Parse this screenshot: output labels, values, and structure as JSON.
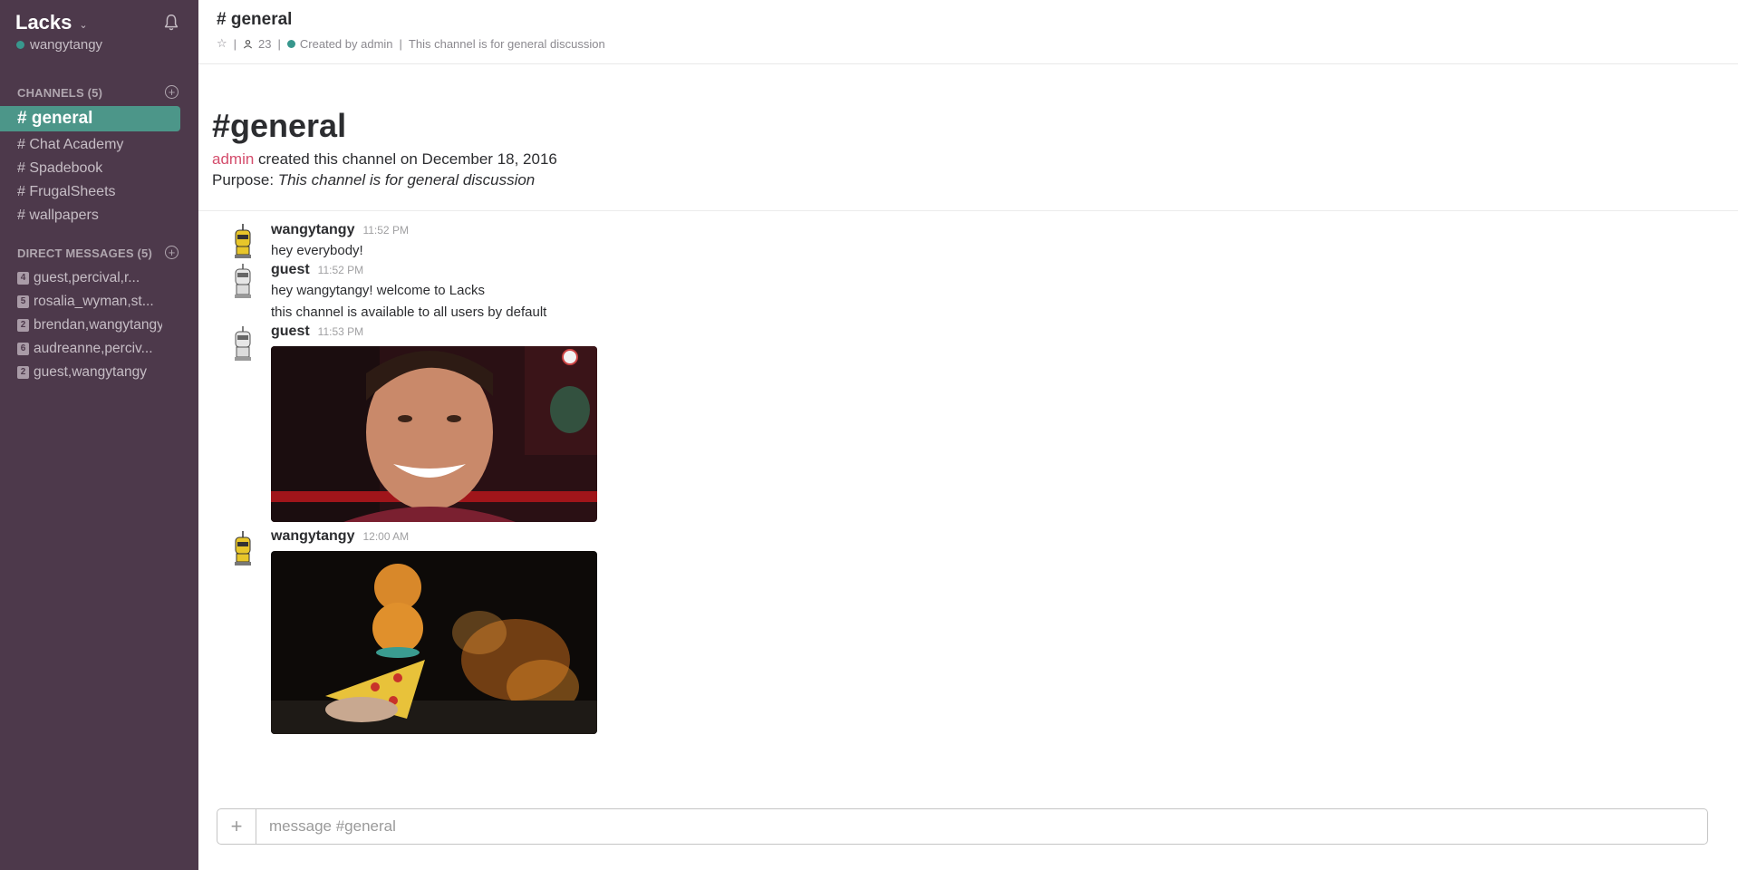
{
  "sidebar": {
    "team_name": "Lacks",
    "user": "wangytangy",
    "channels_title": "CHANNELS (5)",
    "channels": [
      {
        "label": "# general",
        "active": true
      },
      {
        "label": "# Chat Academy"
      },
      {
        "label": "# Spadebook"
      },
      {
        "label": "# FrugalSheets"
      },
      {
        "label": "# wallpapers"
      }
    ],
    "dms_title": "DIRECT MESSAGES (5)",
    "dms": [
      {
        "count": "4",
        "label": "guest,percival,r..."
      },
      {
        "count": "5",
        "label": "rosalia_wyman,st..."
      },
      {
        "count": "2",
        "label": "brendan,wangytangy"
      },
      {
        "count": "6",
        "label": "audreanne,perciv..."
      },
      {
        "count": "2",
        "label": "guest,wangytangy"
      }
    ]
  },
  "header": {
    "title": "# general",
    "star": "☆",
    "members": "23",
    "created_by": "Created by admin",
    "purpose": "This channel is for general discussion"
  },
  "intro": {
    "title": "#general",
    "creator": "admin",
    "created_text": "created this channel on December 18, 2016",
    "purpose_label": "Purpose:",
    "purpose_text": "This channel is for general discussion"
  },
  "messages": [
    {
      "author": "wangytangy",
      "time": "11:52 PM",
      "lines": [
        "hey everybody!"
      ]
    },
    {
      "author": "guest",
      "time": "11:52 PM",
      "lines": [
        "hey wangytangy! welcome to Lacks",
        "this channel is available to all users by default"
      ]
    },
    {
      "author": "guest",
      "time": "11:53 PM",
      "lines": []
    },
    {
      "author": "wangytangy",
      "time": "12:00 AM",
      "lines": []
    }
  ],
  "composer": {
    "placeholder": "message #general",
    "plus": "+"
  },
  "colors": {
    "sidebar_bg": "#4d394b",
    "active_channel": "#4c9689",
    "presence": "#38978d",
    "admin_link": "#d44d6c"
  }
}
